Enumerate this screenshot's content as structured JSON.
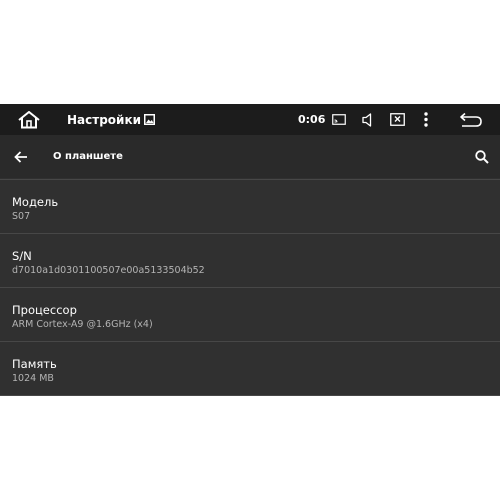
{
  "status_bar": {
    "app_title": "Настройки",
    "time": "0:06",
    "icons": [
      "home-icon",
      "image-icon",
      "cast-icon",
      "volume-icon",
      "screen-x-icon",
      "more-vert-icon",
      "back-icon"
    ]
  },
  "action_bar": {
    "title": "О планшете",
    "icons": [
      "arrow-back-icon",
      "search-icon"
    ]
  },
  "items": [
    {
      "title": "Модель",
      "value": "S07"
    },
    {
      "title": "S/N",
      "value": "d7010a1d0301100507e00a5133504b52"
    },
    {
      "title": "Процессор",
      "value": "ARM Cortex-A9 @1.6GHz (x4)"
    },
    {
      "title": "Память",
      "value": "1024 MB"
    }
  ],
  "colors": {
    "status_bar": "#1c1c1c",
    "action_bar": "#2a2a2a",
    "background": "#303030",
    "divider": "#474747",
    "text_primary": "#ffffff",
    "text_secondary": "#b4b4b4"
  }
}
